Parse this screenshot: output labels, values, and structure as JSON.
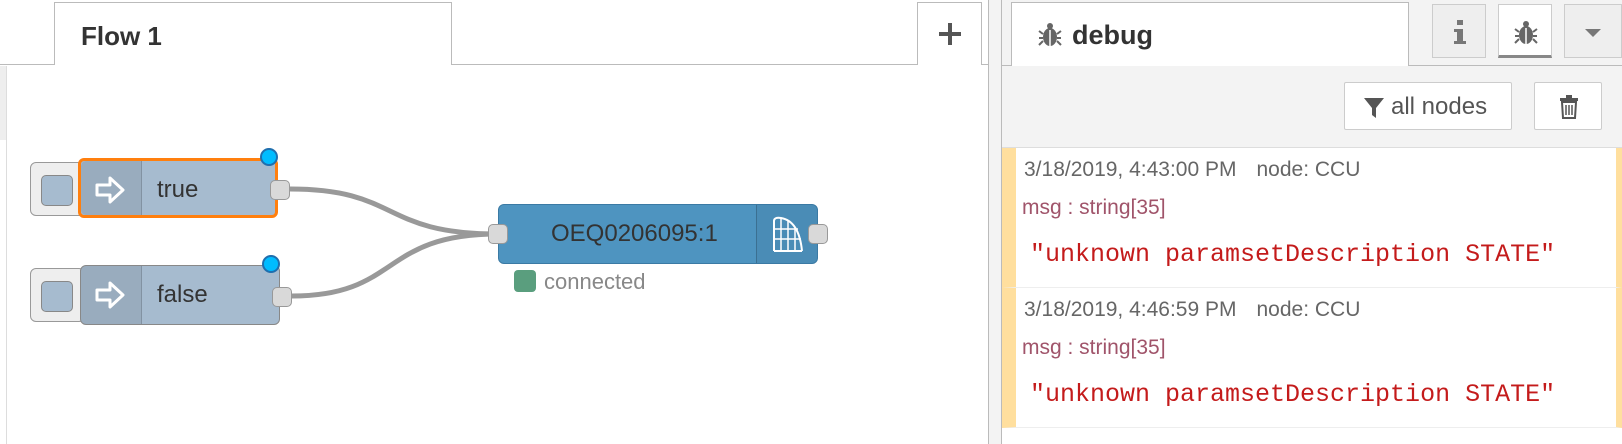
{
  "workspace": {
    "tabs": [
      {
        "label": "Flow 1"
      }
    ],
    "add_tab_icon": "plus-icon",
    "nodes": {
      "true_inject": {
        "label": "true",
        "icon": "arrow-in-icon",
        "selected": true
      },
      "false_inject": {
        "label": "false",
        "icon": "arrow-in-icon",
        "selected": false
      },
      "ccu_node": {
        "label": "OEQ0206095:1",
        "icon": "ccu-icon",
        "status": "connected",
        "status_color": "#5a9e7e"
      }
    },
    "colors": {
      "inject": "#a6bbcf",
      "ccu": "#4e94c0",
      "selection": "#ff7f0e",
      "changed": "#00bcff",
      "wire": "#999999"
    }
  },
  "sidebar": {
    "active_tab": {
      "label": "debug",
      "icon": "bug-icon"
    },
    "buttons": [
      {
        "name": "info",
        "icon": "info-icon"
      },
      {
        "name": "debug",
        "icon": "bug-icon"
      },
      {
        "name": "menu",
        "icon": "caret-down-icon"
      }
    ],
    "toolbar": {
      "filter_label": "all nodes",
      "filter_icon": "filter-icon",
      "clear_icon": "trash-icon"
    },
    "messages": [
      {
        "timestamp": "3/18/2019, 4:43:00 PM",
        "node": "node: CCU",
        "topic": "msg : string[35]",
        "payload": "\"unknown paramsetDescription STATE\""
      },
      {
        "timestamp": "3/18/2019, 4:46:59 PM",
        "node": "node: CCU",
        "topic": "msg : string[35]",
        "payload": "\"unknown paramsetDescription STATE\""
      }
    ]
  }
}
